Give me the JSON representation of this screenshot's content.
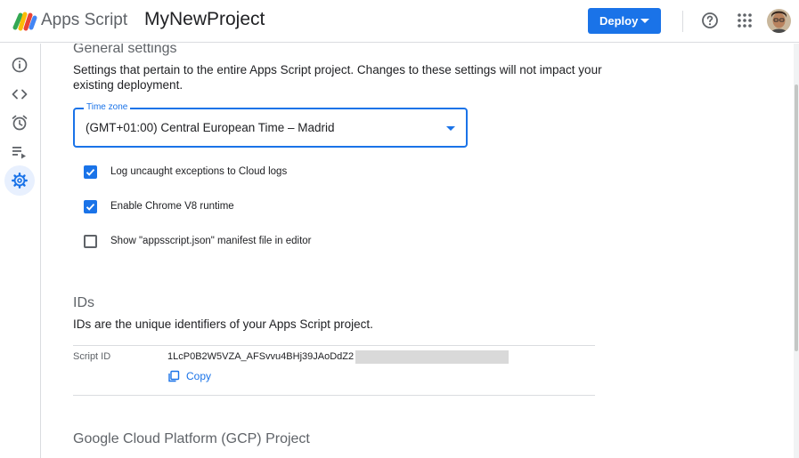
{
  "header": {
    "app_name": "Apps Script",
    "project_name": "MyNewProject",
    "deploy_label": "Deploy",
    "icons": [
      "apps-script-logo",
      "help-icon",
      "apps-grid-icon",
      "user-avatar"
    ]
  },
  "rail": {
    "items": [
      {
        "name": "overview",
        "icon": "info-icon"
      },
      {
        "name": "editor",
        "icon": "code-icon"
      },
      {
        "name": "triggers",
        "icon": "alarm-clock-icon"
      },
      {
        "name": "executions",
        "icon": "list-play-icon"
      },
      {
        "name": "project-settings",
        "icon": "gear-icon",
        "active": true
      }
    ]
  },
  "general": {
    "title": "General settings",
    "description": "Settings that pertain to the entire Apps Script project. Changes to these settings will not impact your existing deployment.",
    "timezone_label": "Time zone",
    "timezone_value": "(GMT+01:00) Central European Time – Madrid",
    "checkboxes": [
      {
        "label": "Log uncaught exceptions to Cloud logs",
        "checked": true
      },
      {
        "label": "Enable Chrome V8 runtime",
        "checked": true
      },
      {
        "label": "Show \"appsscript.json\" manifest file in editor",
        "checked": false
      }
    ]
  },
  "ids": {
    "title": "IDs",
    "description": "IDs are the unique identifiers of your Apps Script project.",
    "script_id_label": "Script ID",
    "script_id_value": "1LcP0B2W5VZA_AFSvvu4BHj39JAoDdZ2",
    "copy_label": "Copy"
  },
  "gcp": {
    "title": "Google Cloud Platform (GCP) Project"
  },
  "colors": {
    "accent": "#1a73e8",
    "text": "#202124",
    "secondary_text": "#5f6368",
    "active_rail_bg": "#e8f0fe"
  }
}
